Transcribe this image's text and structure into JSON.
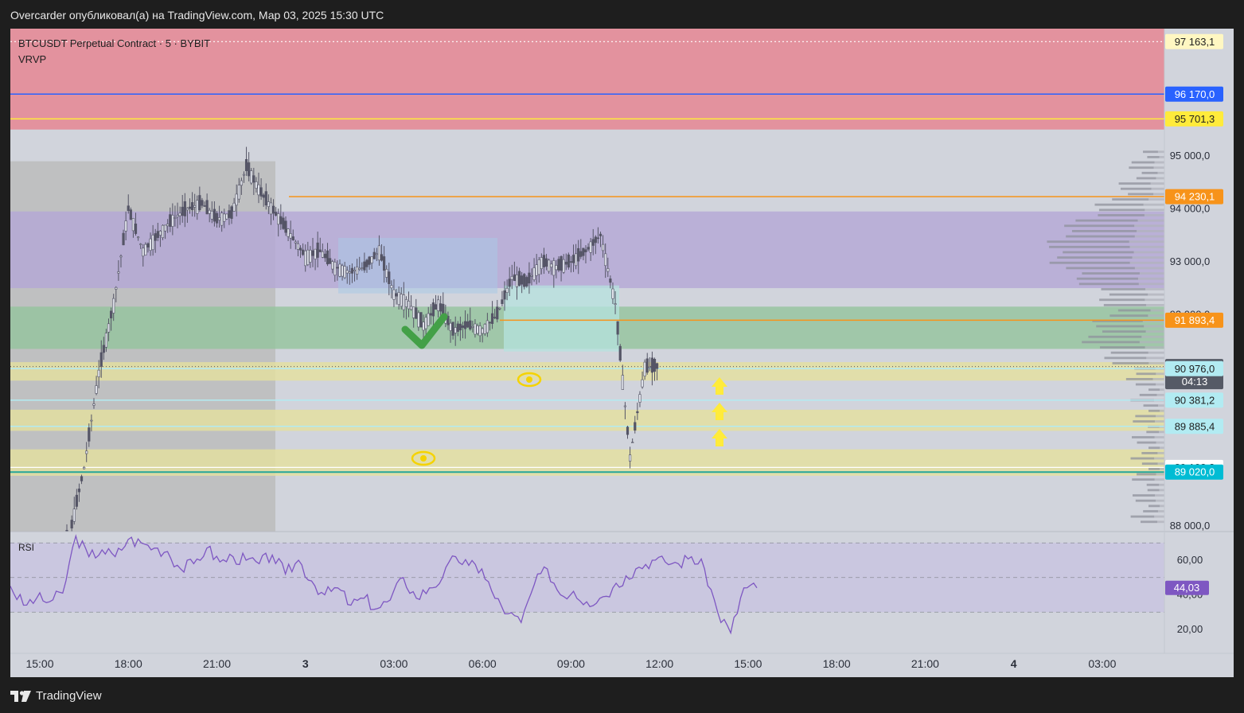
{
  "header": {
    "publisher_text": "Overcarder опубликовал(а) на TradingView.com, Мар 03, 2025 15:30 UTC"
  },
  "footer": {
    "brand": "TradingView"
  },
  "legend": {
    "symbol_line": "BTCUSDT Perpetual Contract · 5 · BYBIT",
    "indicator": "VRVP"
  },
  "rsi_panel": {
    "label": "RSI"
  },
  "colors": {
    "background": "#d1d4dc",
    "supply_zone": "#e3929e",
    "purple_zone": "#b4a6d6",
    "green_zone": "#93c39c",
    "yellow_zone": "#e5e09d",
    "gray_box": "#bcbcbc",
    "candle": "#555566",
    "rsi_line": "#7e57c2",
    "rsi_band": "#c9c5e0",
    "orange_line": "#f7931a",
    "blue_line": "#2962ff",
    "yellow_line": "#ffeb3b"
  },
  "chart_data": [
    {
      "type": "candlestick",
      "title": "BTCUSDT Perpetual Contract · 5 · BYBIT",
      "x_tick_labels": [
        "15:00",
        "18:00",
        "21:00",
        "3",
        "03:00",
        "06:00",
        "09:00",
        "12:00",
        "15:00",
        "18:00",
        "21:00",
        "4",
        "03:00"
      ],
      "y_tick_labels": [
        "95 000,0",
        "94 000,0",
        "93 000,0",
        "92 000,0",
        "88 000,0"
      ],
      "ylim": [
        87900,
        97700
      ],
      "grid": false,
      "price_series": {
        "x_hours": [
          0,
          0.5,
          1,
          1.5,
          2,
          2.5,
          3,
          3.5,
          4,
          4.5,
          5,
          5.5,
          6,
          6.5,
          7,
          7.5,
          8,
          8.5,
          9,
          9.5,
          10,
          10.5,
          11,
          11.5,
          12,
          12.5,
          13,
          13.5,
          14,
          14.5,
          15,
          15.5,
          16,
          16.5,
          17,
          17.5,
          18,
          18.5,
          19,
          19.5,
          20,
          20.5,
          21,
          21.5,
          22,
          22.5,
          23,
          23.5,
          24,
          24.25
        ],
        "close": [
          87300,
          87500,
          87800,
          89100,
          90900,
          92200,
          94000,
          93200,
          93500,
          93800,
          94000,
          94100,
          93800,
          93900,
          94800,
          94300,
          93900,
          93500,
          93100,
          93200,
          92900,
          92800,
          92900,
          93200,
          92400,
          92200,
          91800,
          92200,
          91700,
          91800,
          91700,
          92000,
          92700,
          92600,
          93000,
          92900,
          93000,
          93200,
          93500,
          92200,
          89300,
          91000,
          91016.6
        ]
      },
      "price_labels": [
        {
          "text": "97 163,1",
          "value": 97163.1,
          "color": "#fff7c2"
        },
        {
          "text": "96 170,0",
          "value": 96170.0,
          "color": "#2962ff"
        },
        {
          "text": "95 701,3",
          "value": 95701.3,
          "color": "#ffeb3b"
        },
        {
          "text": "94 230,1",
          "value": 94230.1,
          "color": "#f7931a"
        },
        {
          "text": "91 893,4",
          "value": 91893.4,
          "color": "#f7931a"
        },
        {
          "text": "91 016,6",
          "value": 91016.6,
          "color": "#555a66"
        },
        {
          "text": "04:13",
          "value": 91016.6,
          "color": "#555a66"
        },
        {
          "text": "90 976,0",
          "value": 90976.0,
          "color": "#b2ebf2"
        },
        {
          "text": "90 381,2",
          "value": 90381.2,
          "color": "#b2ebf2"
        },
        {
          "text": "89 885,4",
          "value": 89885.4,
          "color": "#b2ebf2"
        },
        {
          "text": "89 108,2",
          "value": 89108.2,
          "color": "#ffffff"
        },
        {
          "text": "89 020,0",
          "value": 89020.0,
          "color": "#00bcd4"
        }
      ],
      "zones": [
        {
          "name": "supply",
          "from": 95500,
          "to": 97700
        },
        {
          "name": "purple",
          "from": 92500,
          "to": 93950
        },
        {
          "name": "green",
          "from": 91350,
          "to": 92150
        },
        {
          "name": "yellow-upper",
          "from": 90750,
          "to": 91100
        },
        {
          "name": "yellow-mid",
          "from": 89800,
          "to": 90200
        },
        {
          "name": "yellow-lower",
          "from": 88950,
          "to": 89450
        }
      ]
    },
    {
      "type": "line",
      "title": "RSI",
      "y_tick_labels": [
        "60,00",
        "40,00",
        "20,00"
      ],
      "ylim": [
        12,
        76
      ],
      "band": [
        30,
        70
      ],
      "last_value_label": "44,03",
      "series": [
        {
          "x_hours": [
            0,
            0.5,
            1,
            1.5,
            2,
            2.5,
            3,
            3.5,
            4,
            4.5,
            5,
            5.5,
            6,
            6.5,
            7,
            7.5,
            8,
            8.5,
            9,
            9.5,
            10,
            10.5,
            11,
            11.5,
            12,
            12.5,
            13,
            13.5,
            14,
            14.5,
            15,
            15.5,
            16,
            16.5,
            17,
            17.5,
            18,
            18.5,
            19,
            19.5,
            20,
            20.5,
            21,
            21.5,
            22,
            22.5,
            23,
            23.5,
            24,
            24.25
          ],
          "values": [
            45,
            34,
            38,
            36,
            41,
            74,
            62,
            66,
            62,
            72,
            70,
            67,
            65,
            55,
            58,
            67,
            59,
            62,
            60,
            58,
            63,
            52,
            60,
            48,
            40,
            44,
            34,
            38,
            32,
            37,
            50,
            38,
            44,
            50,
            62,
            57,
            55,
            38,
            29,
            24,
            46,
            55,
            40,
            42,
            36,
            38,
            44,
            51,
            56,
            60,
            59,
            58,
            62,
            55,
            30,
            18,
            44,
            44.03
          ]
        }
      ]
    }
  ]
}
